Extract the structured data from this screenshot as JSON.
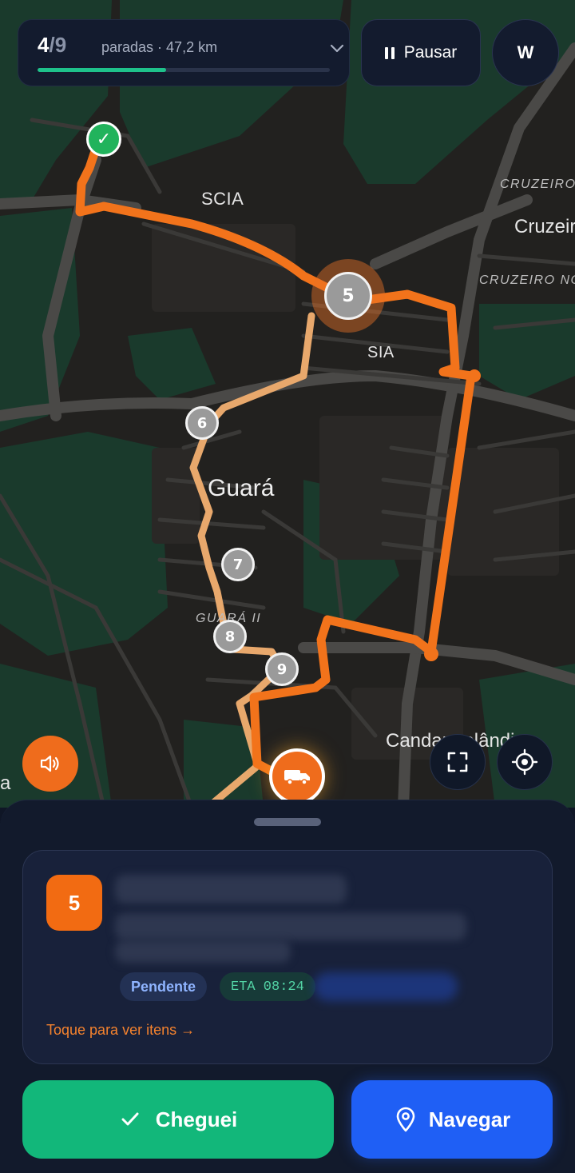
{
  "progress": {
    "completed": "4",
    "separator": "/",
    "total": "9",
    "summary": "paradas · 47,2 km",
    "fraction": 0.44
  },
  "toolbar": {
    "pause_label": "Pausar",
    "avatar_initial": "W"
  },
  "map": {
    "labels": {
      "scia": "SCIA",
      "sia": "SIA",
      "guara": "Guará",
      "guara_ii": "GUARÁ II",
      "cruzeiro_upper": "CRUZEIRO",
      "cruzeiro": "Cruzeir",
      "cruzeiro_novo": "CRUZEIRO NO",
      "candangolandia": "Candangolândi",
      "left_edge": "a"
    },
    "stops": {
      "current": "5",
      "s6": "6",
      "s7": "7",
      "s8": "8",
      "s9": "9"
    },
    "icons": {
      "done": "checkmark-icon",
      "vehicle": "truck-icon"
    }
  },
  "controls": {
    "sound": "speaker-icon",
    "fullscreen": "expand-icon",
    "locate": "crosshair-icon"
  },
  "stop_card": {
    "sequence": "5",
    "status": "Pendente",
    "eta": "ETA 08:24",
    "hint": "Toque para ver itens →"
  },
  "actions": {
    "arrived": "Cheguei",
    "navigate": "Navegar"
  },
  "colors": {
    "route_active": "#f2731b",
    "route_upcoming": "#e8a86c",
    "success": "#12b77a",
    "primary": "#1f5ff5",
    "accent": "#f26b12"
  }
}
